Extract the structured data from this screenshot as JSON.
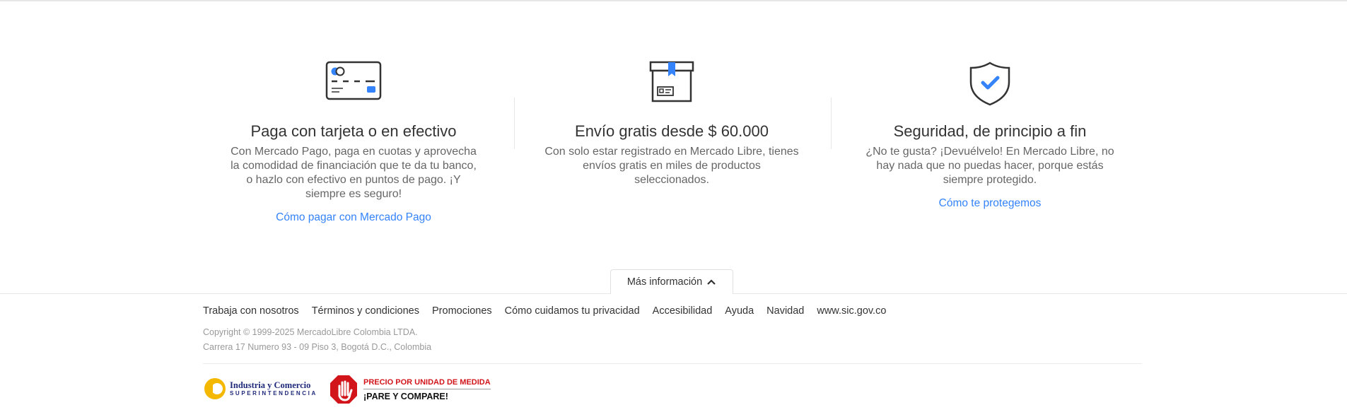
{
  "features": [
    {
      "icon": "credit-card-icon",
      "title": "Paga con tarjeta o en efectivo",
      "description": "Con Mercado Pago, paga en cuotas y aprovecha la comodidad de financiación que te da tu banco, o hazlo con efectivo en puntos de pago. ¡Y siempre es seguro!",
      "link": "Cómo pagar con Mercado Pago"
    },
    {
      "icon": "shipping-box-icon",
      "title": "Envío gratis desde $ 60.000",
      "description": "Con solo estar registrado en Mercado Libre, tienes envíos gratis en miles de productos seleccionados.",
      "link": ""
    },
    {
      "icon": "shield-check-icon",
      "title": "Seguridad, de principio a fin",
      "description": "¿No te gusta? ¡Devuélvelo! En Mercado Libre, no hay nada que no puedas hacer, porque estás siempre protegido.",
      "link": "Cómo te protegemos"
    }
  ],
  "more_info": {
    "label": "Más información",
    "icon": "chevron-up-icon"
  },
  "footer": {
    "links": [
      "Trabaja con nosotros",
      "Términos y condiciones",
      "Promociones",
      "Cómo cuidamos tu privacidad",
      "Accesibilidad",
      "Ayuda",
      "Navidad",
      "www.sic.gov.co"
    ],
    "copyright": "Copyright © 1999-2025 MercadoLibre Colombia LTDA.",
    "address": "Carrera 17 Numero 93 - 09 Piso 3, Bogotá D.C., Colombia"
  },
  "badges": {
    "sic": {
      "line1": "Industria y Comercio",
      "line2": "SUPERINTENDENCIA"
    },
    "pare": {
      "line1": "PRECIO POR UNIDAD DE MEDIDA",
      "line2": "¡PARE Y COMPARE!"
    }
  },
  "colors": {
    "accent": "#3483fa",
    "link": "#3483fa",
    "sic_blue": "#1f2a7a",
    "pare_red": "#d2141b"
  }
}
